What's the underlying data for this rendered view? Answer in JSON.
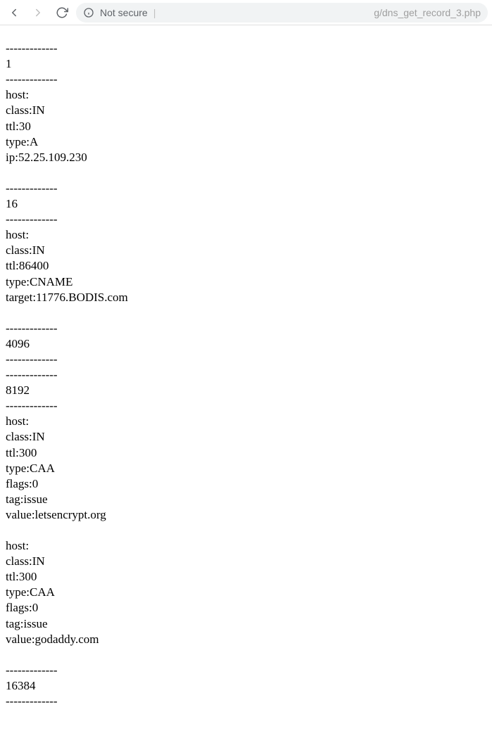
{
  "toolbar": {
    "secure_label": "Not secure",
    "url_tail": "g/dns_get_record_3.php"
  },
  "sep": "-------------",
  "records": {
    "r1": {
      "header_num": "1",
      "host_label": "host:",
      "class": "class:IN",
      "ttl": "ttl:30",
      "type": "type:A",
      "ip": "ip:52.25.109.230"
    },
    "r16": {
      "header_num": "16",
      "host_label": "host:",
      "class": "class:IN",
      "ttl": "ttl:86400",
      "type": "type:CNAME",
      "target": "target:11776.BODIS.com"
    },
    "r4096": {
      "header_num": "4096"
    },
    "r8192": {
      "header_num": "8192",
      "host_label": "host:",
      "class": "class:IN",
      "ttl": "ttl:300",
      "type": "type:CAA",
      "flags": "flags:0",
      "tag": "tag:issue",
      "value": "value:letsencrypt.org"
    },
    "r8192b": {
      "host_label": "host:",
      "class": "class:IN",
      "ttl": "ttl:300",
      "type": "type:CAA",
      "flags": "flags:0",
      "tag": "tag:issue",
      "value": "value:godaddy.com"
    },
    "r16384": {
      "header_num": "16384"
    }
  }
}
